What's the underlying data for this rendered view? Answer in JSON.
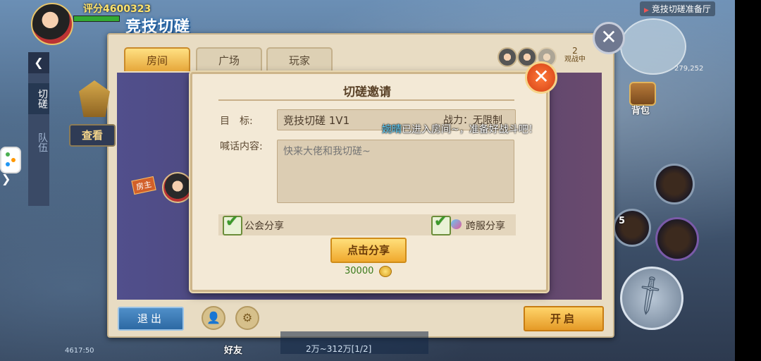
{
  "hud": {
    "score": "评分4600323",
    "page_title": "竞技切磋",
    "topright_label": "竞技切磋准备厅",
    "coords": "279,252",
    "bag_label": "背包",
    "friends_label": "好友",
    "skill_count": "5",
    "time": "4617:50"
  },
  "panel": {
    "tabs": [
      {
        "label": "房间",
        "active": true
      },
      {
        "label": "广场",
        "active": false
      },
      {
        "label": "玩家",
        "active": false
      }
    ],
    "side_tabs": [
      "切磋",
      "队伍"
    ],
    "check_button": "查看",
    "host_badge": "房主",
    "spectate_count": "2",
    "spectate_label": "观战中",
    "exit_button": "退出",
    "start_button": "开启"
  },
  "modal": {
    "title": "切磋邀请",
    "target_label": "目　标:",
    "target_value": "竞技切磋 1V1",
    "power_text": "战力：无限制",
    "message_label": "喊话内容:",
    "message_placeholder": "快来大佬和我切磋~",
    "guild_share_label": "公会分享",
    "cross_server_share_label": "跨服分享",
    "share_button": "点击分享",
    "cost": "30000"
  },
  "notice": {
    "name": "婉晴",
    "text": "已进入房间~，准备好战斗吧！"
  },
  "bottom_chat": {
    "line2": "2万~312万[1/2]"
  }
}
